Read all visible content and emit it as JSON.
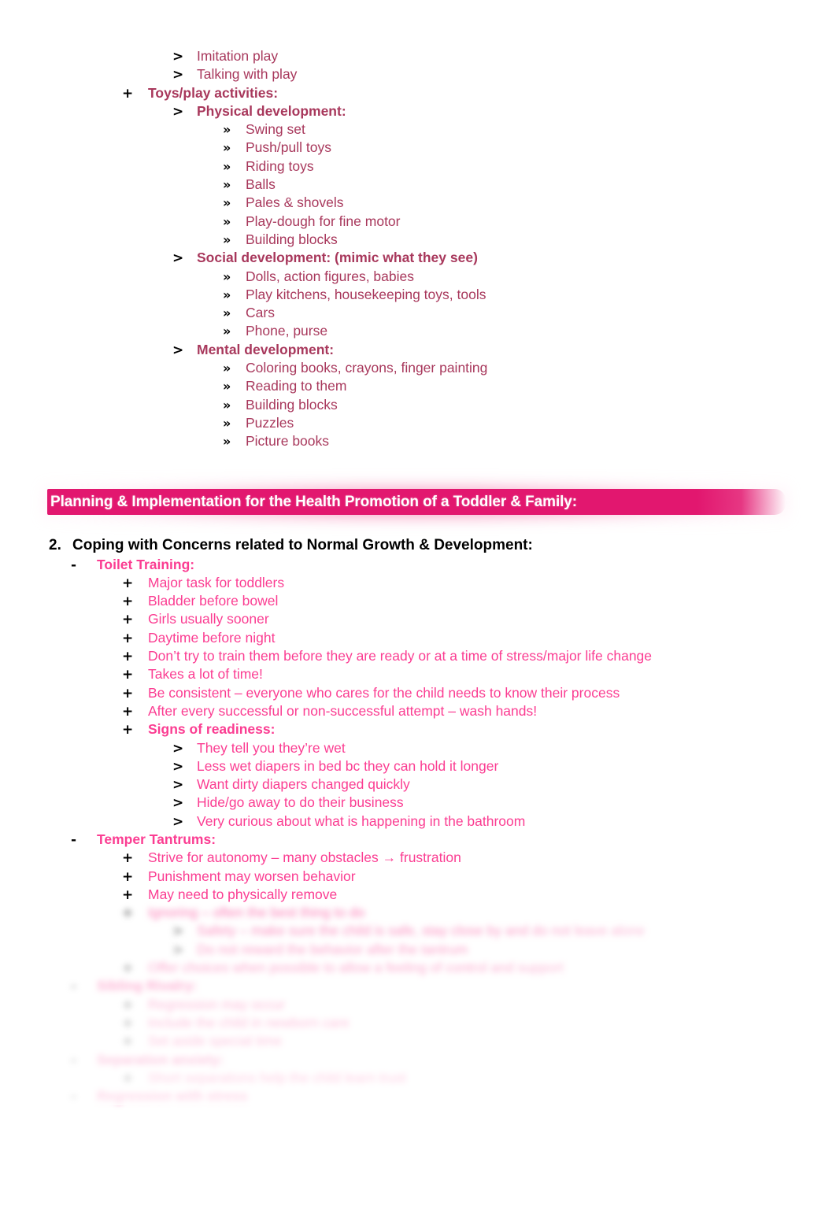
{
  "document": {
    "theme": {
      "rose": "#A8385C",
      "pink": "#FB3D92",
      "banner_bg": "#E2176F",
      "banner_text": "#FFFFFF",
      "black": "#000000"
    }
  },
  "top_section": {
    "continued_items": [
      {
        "marker": ">",
        "text": "Imitation play",
        "bold": false
      },
      {
        "marker": ">",
        "text": "Talking with play",
        "bold": false
      }
    ],
    "toys_heading": {
      "marker": "+",
      "text": "Toys/play activities:"
    },
    "groups": [
      {
        "marker": ">",
        "heading": "Physical development:",
        "items": [
          "Swing set",
          "Push/pull toys",
          "Riding toys",
          "Balls",
          "Pales & shovels",
          "Play-dough for fine motor",
          "Building blocks"
        ]
      },
      {
        "marker": ">",
        "heading": "Social development: (mimic what they see)",
        "items": [
          "Dolls, action figures, babies",
          "Play kitchens, housekeeping toys, tools",
          "Cars",
          "Phone, purse"
        ]
      },
      {
        "marker": ">",
        "heading": "Mental development:",
        "items": [
          "Coloring books, crayons, finger painting",
          "Reading to them",
          "Building blocks",
          "Puzzles",
          "Picture books"
        ]
      }
    ]
  },
  "banner": {
    "title": "Planning & Implementation for the Health Promotion of a Toddler & Family:"
  },
  "numbered_heading": {
    "number": "2.",
    "text": "Coping with Concerns related to Normal Growth & Development:"
  },
  "toilet_training": {
    "marker": "-",
    "heading": "Toilet Training:",
    "bullets": [
      "Major task for toddlers",
      "Bladder before bowel",
      "Girls usually sooner",
      "Daytime before night",
      "Don’t try to train them before they are ready or at a time of stress/major life change",
      "Takes a lot of time!",
      "Be consistent – everyone who cares for the child needs to know their process",
      "After every successful or non-successful attempt – wash hands!"
    ],
    "signs": {
      "marker": "+",
      "heading": "Signs of readiness:",
      "items": [
        "They tell you they’re wet",
        "Less wet diapers in bed bc they can hold it longer",
        "Want dirty diapers changed quickly",
        "Hide/go away to do their business",
        "Very curious about what is happening in the bathroom"
      ]
    }
  },
  "temper_tantrums": {
    "marker": "-",
    "heading": "Temper Tantrums:",
    "bullets": [
      "Strive for autonomy – many obstacles → frustration",
      "Punishment may worsen behavior",
      "May need to physically remove"
    ],
    "faded_bullets": [
      {
        "marker": "+",
        "level": "plus",
        "text": "Ignoring – often the best thing to do"
      },
      {
        "marker": ">",
        "level": "gt",
        "text": "Safety – make sure the child is safe, stay close by and do not leave alone"
      },
      {
        "marker": ">",
        "level": "gt",
        "text": "Do not reward the behavior after the tantrum"
      },
      {
        "marker": "+",
        "level": "plus",
        "text": "Offer choices when possible to allow a feeling of control and support"
      },
      {
        "marker": "-",
        "level": "dash",
        "text": "Sibling Rivalry:"
      },
      {
        "marker": "+",
        "level": "plus",
        "text": "Regression may occur"
      },
      {
        "marker": "+",
        "level": "plus",
        "text": "Include the child in newborn care"
      },
      {
        "marker": "+",
        "level": "plus",
        "text": "Set aside special time"
      },
      {
        "marker": "-",
        "level": "dash",
        "text": "Separation anxiety:"
      },
      {
        "marker": "+",
        "level": "plus",
        "text": "Short separations help the child learn trust"
      },
      {
        "marker": "-",
        "level": "dash",
        "text": "Regression with stress"
      }
    ]
  }
}
